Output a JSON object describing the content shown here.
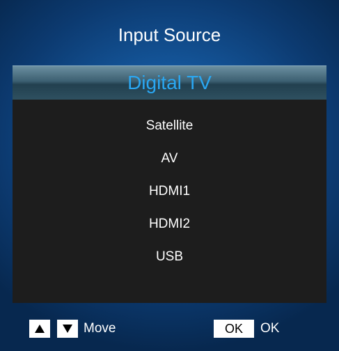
{
  "dialog": {
    "title": "Input Source",
    "selected_source": "Digital TV",
    "sources": [
      "Satellite",
      "AV",
      "HDMI1",
      "HDMI2",
      "USB"
    ]
  },
  "footer": {
    "move_label": "Move",
    "ok_key": "OK",
    "ok_label": "OK"
  },
  "icons": {
    "up": "up-arrow-key-icon",
    "down": "down-arrow-key-icon"
  },
  "colors": {
    "selected_text": "#2aa7f2",
    "background": "#145599",
    "list_background": "#1d1d1d"
  }
}
